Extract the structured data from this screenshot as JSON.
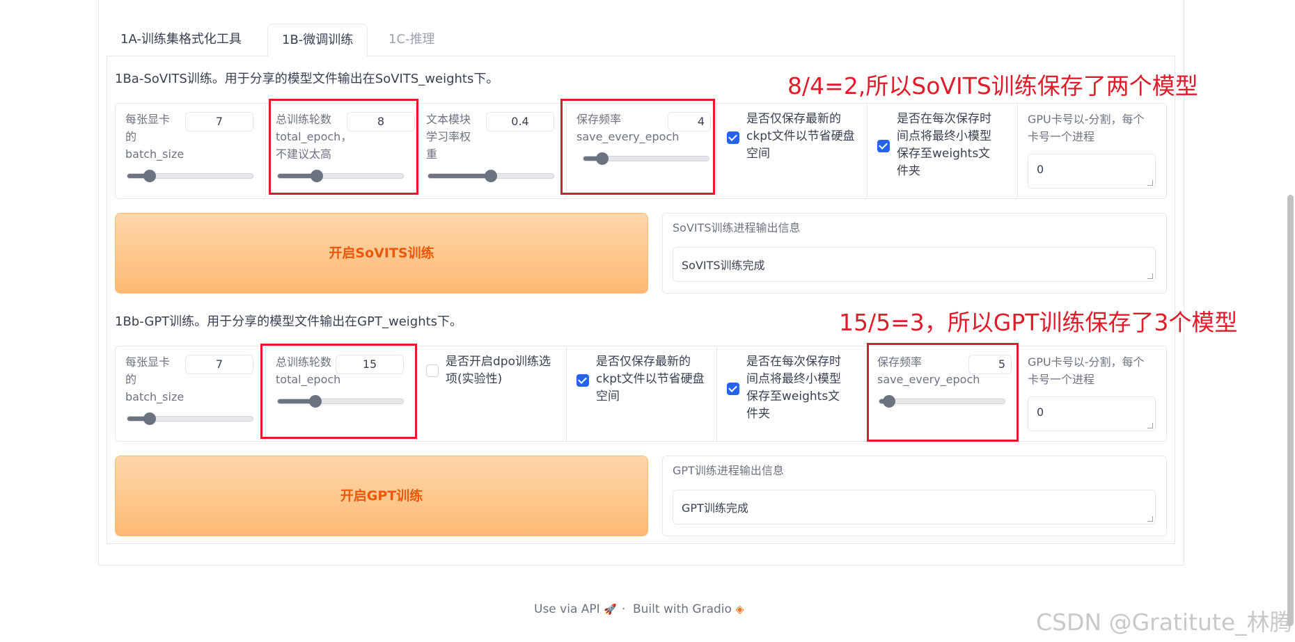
{
  "tabs": [
    {
      "label": "1A-训练集格式化工具"
    },
    {
      "label": "1B-微调训练"
    },
    {
      "label": "1C-推理"
    }
  ],
  "sovits": {
    "section_title": "1Ba-SoVITS训练。用于分享的模型文件输出在SoVITS_weights下。",
    "batch_size": {
      "label": "每张显卡的batch_size",
      "value": "7",
      "level": 0.18
    },
    "total_epoch": {
      "label": "总训练轮数total_epoch，不建议太高",
      "value": "8",
      "level": 0.31
    },
    "text_lr": {
      "label": "文本模块学习率权重",
      "value": "0.4",
      "level": 0.5
    },
    "save_every_epoch": {
      "label": "保存频率save_every_epoch",
      "value": "4",
      "level": 0.15
    },
    "save_latest_only": {
      "label": "是否仅保存最新的ckpt文件以节省硬盘空间",
      "checked": true
    },
    "save_small_each": {
      "label": "是否在每次保存时间点将最终小模型保存至weights文件夹",
      "checked": true
    },
    "gpu_ids": {
      "label": "GPU卡号以-分割，每个卡号一个进程",
      "value": "0"
    },
    "start_button": "开启SoVITS训练",
    "output_label": "SoVITS训练进程输出信息",
    "output_value": "SoVITS训练完成"
  },
  "gpt": {
    "section_title": "1Bb-GPT训练。用于分享的模型文件输出在GPT_weights下。",
    "batch_size": {
      "label": "每张显卡的batch_size",
      "value": "7",
      "level": 0.18
    },
    "total_epoch": {
      "label": "总训练轮数total_epoch",
      "value": "15",
      "level": 0.3
    },
    "dpo": {
      "label": "是否开启dpo训练选项(实验性)",
      "checked": false
    },
    "save_latest_only": {
      "label": "是否仅保存最新的ckpt文件以节省硬盘空间",
      "checked": true
    },
    "save_small_each": {
      "label": "是否在每次保存时间点将最终小模型保存至weights文件夹",
      "checked": true
    },
    "save_every_epoch": {
      "label": "保存频率save_every_epoch",
      "value": "5",
      "level": 0.08
    },
    "gpu_ids": {
      "label": "GPU卡号以-分割，每个卡号一个进程",
      "value": "0"
    },
    "start_button": "开启GPT训练",
    "output_label": "GPT训练进程输出信息",
    "output_value": "GPT训练完成"
  },
  "annotations": {
    "sovits_note": "8/4=2,所以SoVITS训练保存了两个模型",
    "gpt_note": "15/5=3，所以GPT训练保存了3个模型"
  },
  "footer": {
    "api": "Use via API",
    "sep": "·",
    "built": "Built with Gradio"
  },
  "watermark": "CSDN @Gratitute_林腾",
  "colors": {
    "accent": "#2563eb",
    "button": "#fdba74",
    "button_text": "#ea580c",
    "highlight": "#e01b2a"
  }
}
